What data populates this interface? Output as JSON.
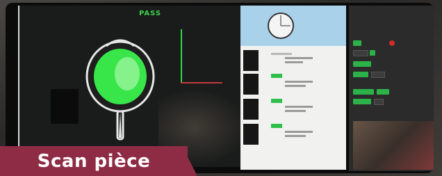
{
  "scene": {
    "status_text": "PASS",
    "caption": "Scan pièce"
  },
  "colors": {
    "caption_band": "#8e2c46",
    "pass_green": "#3bd14b",
    "accent_green": "#2db24a"
  },
  "icons": {
    "pan": "skillet-icon",
    "preview_pan": "skillet-outline-icon",
    "status": "record-circle-icon"
  }
}
